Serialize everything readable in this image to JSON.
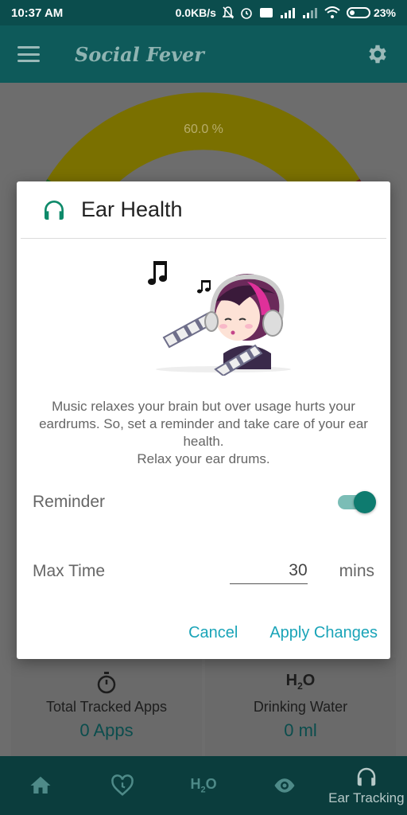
{
  "status_bar": {
    "time": "10:37 AM",
    "network_speed": "0.0KB/s",
    "battery": "23%"
  },
  "app_bar": {
    "title": "Social Fever",
    "menu_icon": "hamburger-menu-icon",
    "settings_icon": "gear-icon"
  },
  "background": {
    "gauge_label": "60.0 %",
    "gauge_value_percent": 60.0,
    "cards": [
      {
        "icon": "stopwatch-icon",
        "label": "Total Tracked Apps",
        "value": "0 Apps"
      },
      {
        "icon": "H2O",
        "label": "Drinking Water",
        "value": "0 ml"
      }
    ]
  },
  "bottom_nav": {
    "items": [
      {
        "icon": "home-icon"
      },
      {
        "icon": "heart-clock-icon"
      },
      {
        "icon": "H2O"
      },
      {
        "icon": "eye-icon"
      },
      {
        "icon": "headphones-icon",
        "label": "Ear Tracking",
        "active": true
      }
    ]
  },
  "dialog": {
    "title": "Ear Health",
    "header_icon": "headphones-icon",
    "description_lines": [
      "Music relaxes your brain but over usage hurts your",
      "eardrums. So, set a reminder and take care of your ear",
      "health.",
      "Relax your ear drums."
    ],
    "reminder_label": "Reminder",
    "reminder_enabled": true,
    "max_time_label": "Max Time",
    "max_time_value": "30",
    "max_time_unit": "mins",
    "cancel_label": "Cancel",
    "apply_label": "Apply Changes"
  },
  "colors": {
    "primary": "#0e5a5a",
    "accent": "#0e7b6f",
    "action_text": "#1aa4b8",
    "gauge_yellow": "#c9b400",
    "gauge_green": "#2e9a3a",
    "gauge_red": "#c0392b"
  }
}
